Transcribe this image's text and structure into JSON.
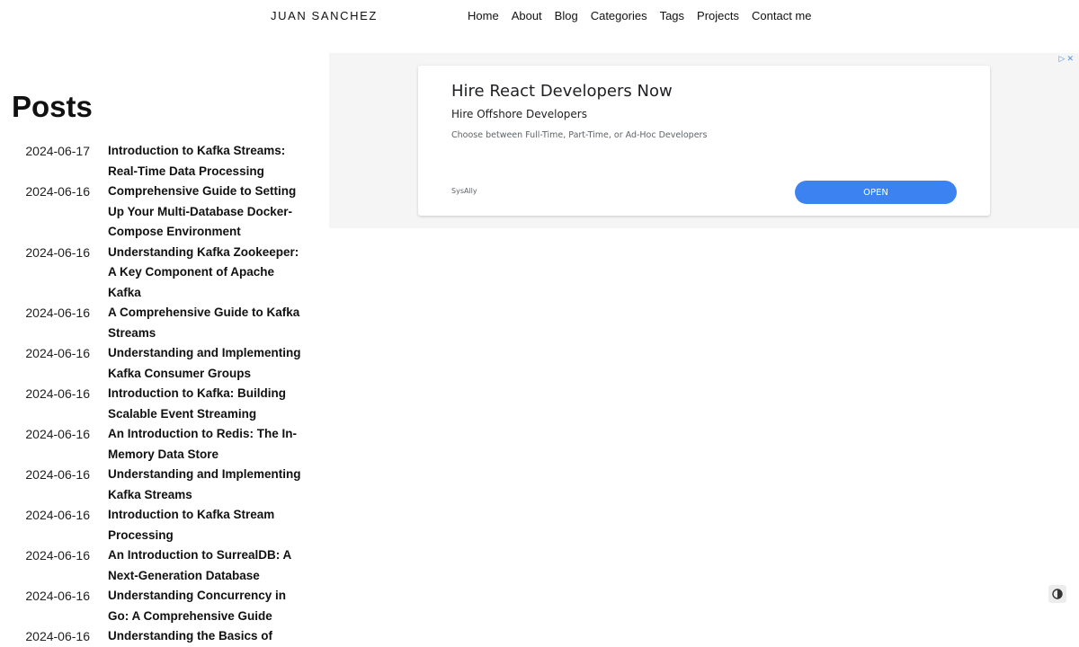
{
  "header": {
    "brand": "JUAN SANCHEZ",
    "nav": [
      "Home",
      "About",
      "Blog",
      "Categories",
      "Tags",
      "Projects",
      "Contact me"
    ]
  },
  "main": {
    "heading": "Posts",
    "posts": [
      {
        "date": "2024-06-17",
        "title": "Introduction to Kafka Streams: Real-Time Data Processing"
      },
      {
        "date": "2024-06-16",
        "title": "Comprehensive Guide to Setting Up Your Multi-Database Docker-Compose Environment"
      },
      {
        "date": "2024-06-16",
        "title": "Understanding Kafka Zookeeper: A Key Component of Apache Kafka"
      },
      {
        "date": "2024-06-16",
        "title": "A Comprehensive Guide to Kafka Streams"
      },
      {
        "date": "2024-06-16",
        "title": "Understanding and Implementing Kafka Consumer Groups"
      },
      {
        "date": "2024-06-16",
        "title": "Introduction to Kafka: Building Scalable Event Streaming"
      },
      {
        "date": "2024-06-16",
        "title": "An Introduction to Redis: The In-Memory Data Store"
      },
      {
        "date": "2024-06-16",
        "title": "Understanding and Implementing Kafka Streams"
      },
      {
        "date": "2024-06-16",
        "title": "Introduction to Kafka Stream Processing"
      },
      {
        "date": "2024-06-16",
        "title": "An Introduction to SurrealDB: A Next-Generation Database"
      },
      {
        "date": "2024-06-16",
        "title": "Understanding Concurrency in Go: A Comprehensive Guide"
      },
      {
        "date": "2024-06-16",
        "title": "Understanding the Basics of"
      }
    ]
  },
  "ad": {
    "headline": "Hire React Developers Now",
    "subheadline": "Hire Offshore Developers",
    "description": "Choose between Full-Time, Part-Time, or Ad-Hoc Developers",
    "advertiser": "SysAlly",
    "cta": "OPEN",
    "choices_icons": [
      "adchoices-icon",
      "close-icon"
    ],
    "button_color": "#3c82f0"
  },
  "theme_toggle": {
    "icon": "contrast-icon"
  }
}
